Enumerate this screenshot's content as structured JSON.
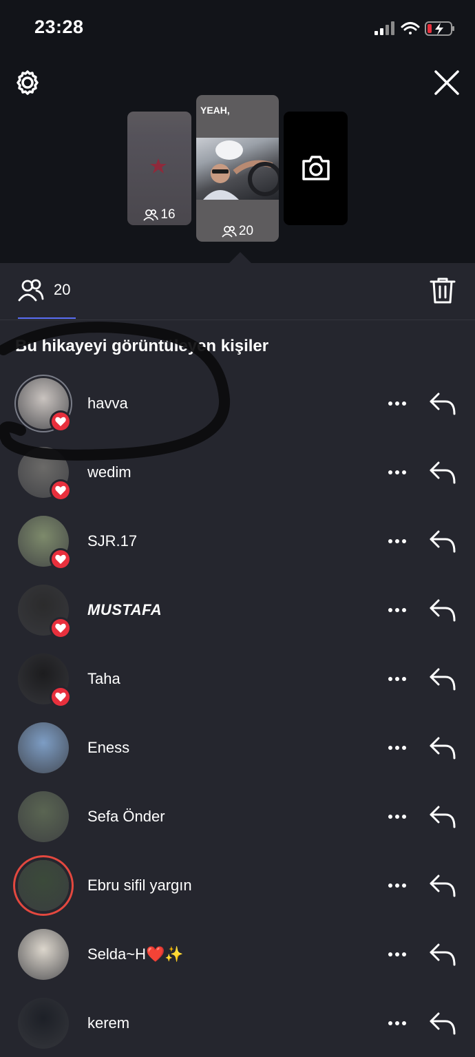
{
  "status_bar": {
    "time": "23:28"
  },
  "stories": [
    {
      "viewers": "16"
    },
    {
      "caption": "YEAH,",
      "viewers": "20"
    },
    {
      "kind": "camera"
    }
  ],
  "viewer_tab": {
    "count": "20"
  },
  "section_title": "Bu hikayeyi görüntüleyen kişiler",
  "viewers": [
    {
      "name": "havva",
      "liked": true,
      "avatar_color": "#c9c3bf",
      "ring": "grey"
    },
    {
      "name": "wedim",
      "liked": true,
      "avatar_color": "#6b6a68"
    },
    {
      "name": "SJR.17",
      "liked": true,
      "avatar_color": "#7d8a6b"
    },
    {
      "name": "MUSTAFA",
      "liked": true,
      "avatar_color": "#2b2b2c",
      "italic": true
    },
    {
      "name": "Taha",
      "liked": true,
      "avatar_color": "#1c1c1e"
    },
    {
      "name": "Eness",
      "liked": false,
      "avatar_color": "#7d9dc4"
    },
    {
      "name": "Sefa Önder",
      "liked": false,
      "avatar_color": "#5a6552"
    },
    {
      "name": "Ebru sifil yargın",
      "liked": false,
      "avatar_color": "#3b4a3a",
      "ring": "story"
    },
    {
      "name": "Selda~H❤️✨",
      "liked": false,
      "avatar_color": "#dcd6cc"
    },
    {
      "name": "kerem",
      "liked": false,
      "avatar_color": "#1d2027"
    }
  ],
  "colors": {
    "accent": "#5b6ef5",
    "heart": "#e8303d",
    "background": "#25262e",
    "header": "#121419"
  }
}
